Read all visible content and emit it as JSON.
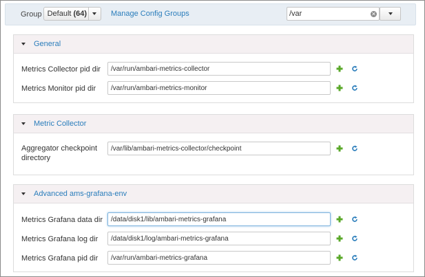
{
  "toolbar": {
    "group_label": "Group",
    "group_button": {
      "name": "Default",
      "count": "(64)"
    },
    "manage_link": "Manage Config Groups",
    "filter": {
      "value": "/var"
    }
  },
  "sections": [
    {
      "title": "General",
      "rows": [
        {
          "label": "Metrics Collector pid dir",
          "value": "/var/run/ambari-metrics-collector"
        },
        {
          "label": "Metrics Monitor pid dir",
          "value": "/var/run/ambari-metrics-monitor"
        }
      ]
    },
    {
      "title": "Metric Collector",
      "rows": [
        {
          "label": "Aggregator checkpoint directory",
          "value": "/var/lib/ambari-metrics-collector/checkpoint"
        }
      ]
    },
    {
      "title": "Advanced ams-grafana-env",
      "rows": [
        {
          "label": "Metrics Grafana data dir",
          "value": "/data/disk1/lib/ambari-metrics-grafana"
        },
        {
          "label": "Metrics Grafana log dir",
          "value": "/data/disk1/log/ambari-metrics-grafana"
        },
        {
          "label": "Metrics Grafana pid dir",
          "value": "/var/run/ambari-metrics-grafana"
        }
      ]
    }
  ],
  "colors": {
    "link": "#2a7dbb",
    "add_icon": "#5aa829",
    "undo_icon": "#2a7dbb",
    "section_header_bg": "#f5f0f2",
    "toolbar_bg": "#e8eef4"
  },
  "icons": {
    "add": "plus-icon",
    "undo": "refresh-icon",
    "clear": "clear-icon",
    "caret": "caret-down-icon"
  }
}
